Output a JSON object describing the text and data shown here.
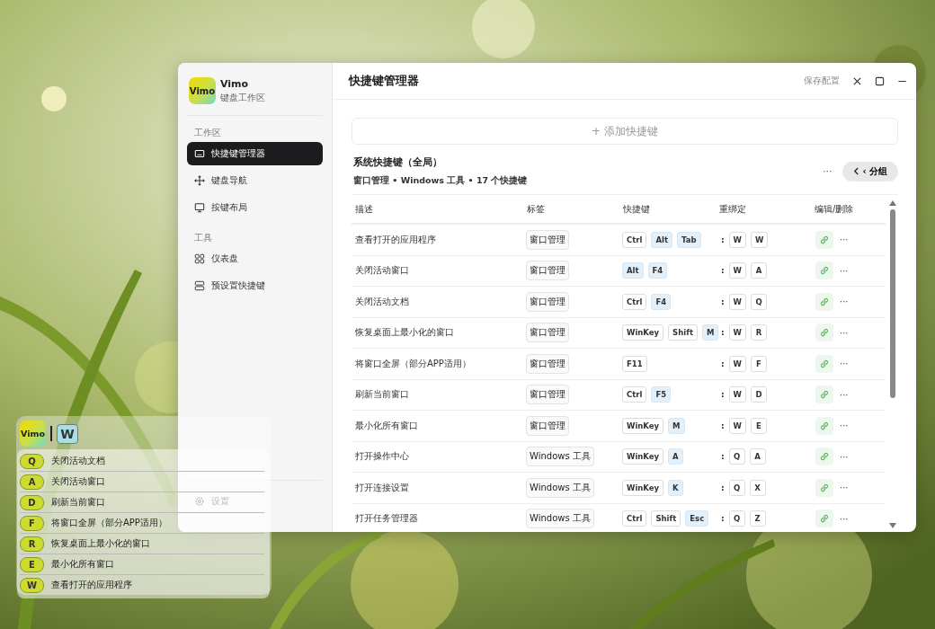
{
  "app": {
    "logo": "Vimo",
    "name": "Vimo",
    "subtitle": "键盘工作区"
  },
  "sidebar": {
    "sections": [
      {
        "title": "工作区",
        "items": [
          {
            "label": "快捷键管理器",
            "selected": true
          },
          {
            "label": "键盘导航",
            "selected": false
          },
          {
            "label": "按键布局",
            "selected": false
          }
        ]
      },
      {
        "title": "工具",
        "items": [
          {
            "label": "仪表盘",
            "selected": false
          },
          {
            "label": "预设置快捷键",
            "selected": false
          }
        ]
      }
    ],
    "footer": {
      "label": "设置"
    }
  },
  "header": {
    "title": "快捷键管理器",
    "save": "保存配置"
  },
  "add_button": "+ 添加快捷键",
  "group": {
    "title": "系统快捷键（全局）",
    "subtitle": "窗口管理 • Windows 工具 • 17 个快捷键",
    "more": "···",
    "back": "‹ 分组"
  },
  "table": {
    "columns": [
      "描述",
      "标签",
      "快捷键",
      "重绑定",
      "编辑/删除"
    ],
    "rows": [
      {
        "desc": "查看打开的应用程序",
        "tag": "窗口管理",
        "keys": [
          {
            "label": "Ctrl",
            "accent": false
          },
          {
            "label": "Alt",
            "accent": true
          },
          {
            "label": "Tab",
            "accent": true
          }
        ],
        "sep": ":",
        "rebind": [
          "W",
          "W"
        ],
        "more": "···"
      },
      {
        "desc": "关闭活动窗口",
        "tag": "窗口管理",
        "keys": [
          {
            "label": "Alt",
            "accent": true
          },
          {
            "label": "F4",
            "accent": true
          }
        ],
        "sep": ":",
        "rebind": [
          "W",
          "A"
        ],
        "more": "···"
      },
      {
        "desc": "关闭活动文档",
        "tag": "窗口管理",
        "keys": [
          {
            "label": "Ctrl",
            "accent": false
          },
          {
            "label": "F4",
            "accent": true
          }
        ],
        "sep": ":",
        "rebind": [
          "W",
          "Q"
        ],
        "more": "···"
      },
      {
        "desc": "恢复桌面上最小化的窗口",
        "tag": "窗口管理",
        "keys": [
          {
            "label": "WinKey",
            "accent": false
          },
          {
            "label": "Shift",
            "accent": false
          },
          {
            "label": "M",
            "accent": true
          }
        ],
        "sep": ":",
        "rebind": [
          "W",
          "R"
        ],
        "more": "···"
      },
      {
        "desc": "将窗口全屏（部分APP适用）",
        "tag": "窗口管理",
        "keys": [
          {
            "label": "F11",
            "accent": false
          }
        ],
        "sep": ":",
        "rebind": [
          "W",
          "F"
        ],
        "more": "···"
      },
      {
        "desc": "刷新当前窗口",
        "tag": "窗口管理",
        "keys": [
          {
            "label": "Ctrl",
            "accent": false
          },
          {
            "label": "F5",
            "accent": true
          }
        ],
        "sep": ":",
        "rebind": [
          "W",
          "D"
        ],
        "more": "···"
      },
      {
        "desc": "最小化所有窗口",
        "tag": "窗口管理",
        "keys": [
          {
            "label": "WinKey",
            "accent": false
          },
          {
            "label": "M",
            "accent": true
          }
        ],
        "sep": ":",
        "rebind": [
          "W",
          "E"
        ],
        "more": "···"
      },
      {
        "desc": "打开操作中心",
        "tag": "Windows 工具",
        "keys": [
          {
            "label": "WinKey",
            "accent": false
          },
          {
            "label": "A",
            "accent": true
          }
        ],
        "sep": ":",
        "rebind": [
          "Q",
          "A"
        ],
        "more": "···"
      },
      {
        "desc": "打开连接设置",
        "tag": "Windows 工具",
        "keys": [
          {
            "label": "WinKey",
            "accent": false
          },
          {
            "label": "K",
            "accent": true
          }
        ],
        "sep": ":",
        "rebind": [
          "Q",
          "X"
        ],
        "more": "···"
      },
      {
        "desc": "打开任务管理器",
        "tag": "Windows 工具",
        "keys": [
          {
            "label": "Ctrl",
            "accent": false
          },
          {
            "label": "Shift",
            "accent": false
          },
          {
            "label": "Esc",
            "accent": true
          }
        ],
        "sep": ":",
        "rebind": [
          "Q",
          "Z"
        ],
        "more": "···"
      }
    ]
  },
  "overlay": {
    "logo": "Vimo",
    "leader": "W",
    "items": [
      {
        "key": "Q",
        "label": "关闭活动文档"
      },
      {
        "key": "A",
        "label": "关闭活动窗口"
      },
      {
        "key": "D",
        "label": "刷新当前窗口"
      },
      {
        "key": "F",
        "label": "将窗口全屏（部分APP适用）"
      },
      {
        "key": "R",
        "label": "恢复桌面上最小化的窗口"
      },
      {
        "key": "E",
        "label": "最小化所有窗口"
      },
      {
        "key": "W",
        "label": "查看打开的应用程序"
      }
    ]
  }
}
